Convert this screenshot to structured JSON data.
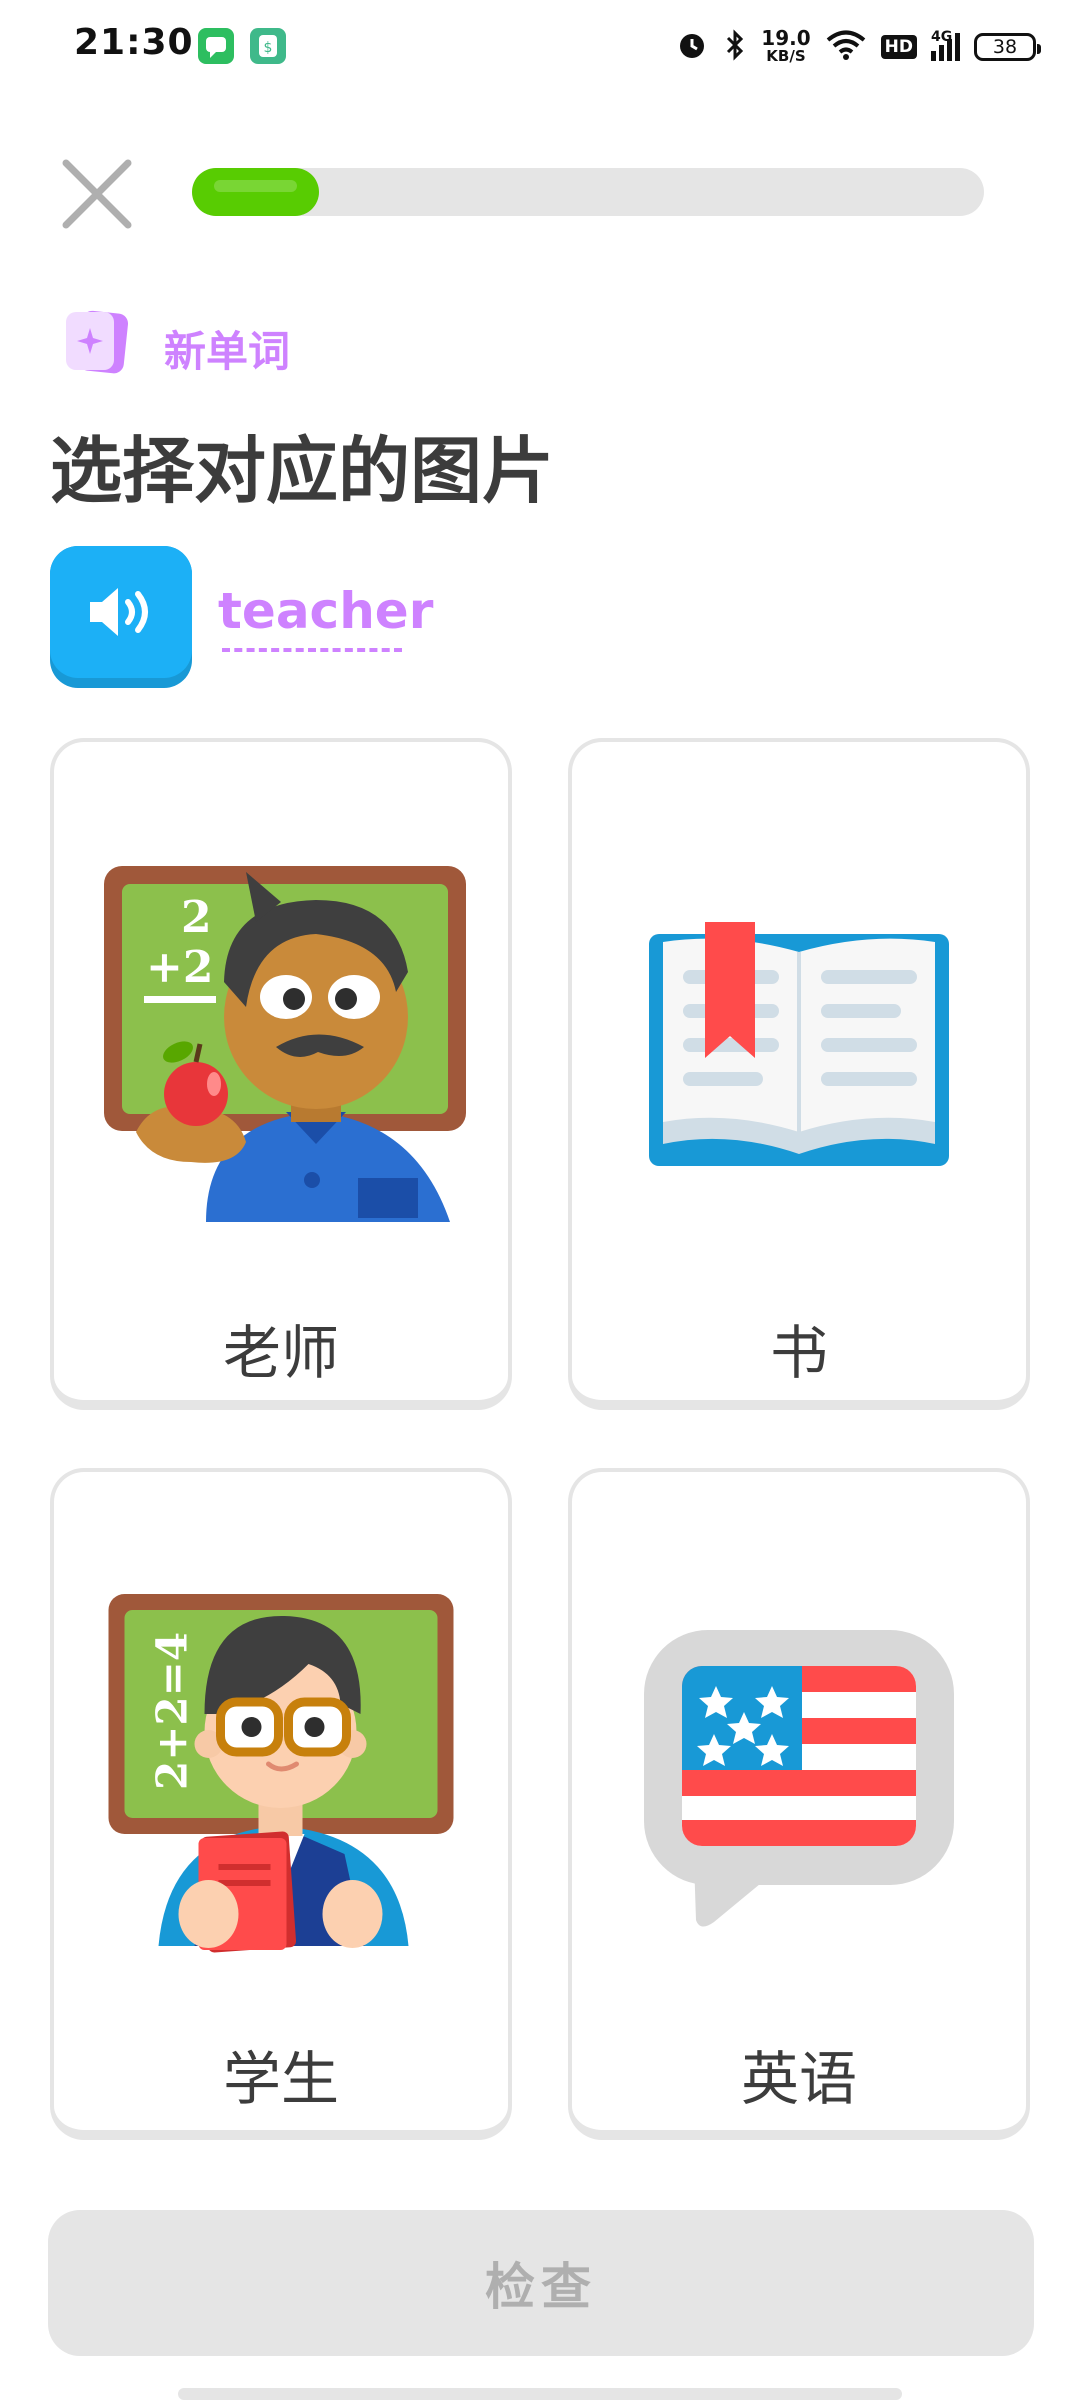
{
  "status_bar": {
    "time": "21:30",
    "net_speed_value": "19.0",
    "net_speed_unit": "KB/S",
    "hd": "HD",
    "signal_label": "4G",
    "battery": "38"
  },
  "lesson": {
    "progress_fraction": 0.16,
    "badge_label": "新单词",
    "instruction": "选择对应的图片",
    "word": "teacher"
  },
  "options": [
    {
      "label": "老师",
      "icon": "teacher-illustration"
    },
    {
      "label": "书",
      "icon": "book-illustration"
    },
    {
      "label": "学生",
      "icon": "student-illustration"
    },
    {
      "label": "英语",
      "icon": "english-flag-bubble-illustration"
    }
  ],
  "actions": {
    "check_label": "检查"
  },
  "colors": {
    "accent_green": "#58cc02",
    "accent_purple": "#ce82ff",
    "accent_blue": "#1cb0f6",
    "border_gray": "#e5e5e5",
    "disabled_text": "#afafaf"
  }
}
